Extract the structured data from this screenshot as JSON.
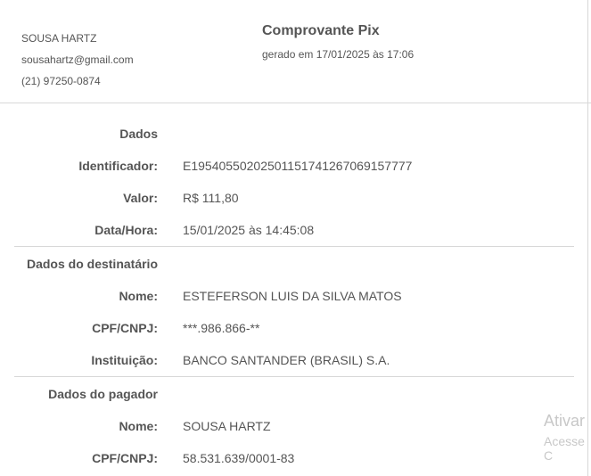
{
  "sender": {
    "name": "SOUSA HARTZ",
    "email": "sousahartz@gmail.com",
    "phone": "(21) 97250-0874"
  },
  "receipt": {
    "title": "Comprovante Pix",
    "generated": "gerado em 17/01/2025 às 17:06"
  },
  "dados": {
    "heading": "Dados",
    "id_label": "Identificador:",
    "id_value": "E19540550202501151741267069157777",
    "valor_label": "Valor:",
    "valor_value": "R$ 111,80",
    "datahora_label": "Data/Hora:",
    "datahora_value": "15/01/2025 às 14:45:08"
  },
  "destinatario": {
    "heading": "Dados do destinatário",
    "nome_label": "Nome:",
    "nome_value": "ESTEFERSON LUIS DA SILVA MATOS",
    "doc_label": "CPF/CNPJ:",
    "doc_value": "***.986.866-**",
    "inst_label": "Instituição:",
    "inst_value": "BANCO SANTANDER (BRASIL) S.A."
  },
  "pagador": {
    "heading": "Dados do pagador",
    "nome_label": "Nome:",
    "nome_value": "SOUSA HARTZ",
    "doc_label": "CPF/CNPJ:",
    "doc_value": "58.531.639/0001-83"
  },
  "watermark": {
    "line1": "Ativar",
    "line2": "Acesse C"
  }
}
